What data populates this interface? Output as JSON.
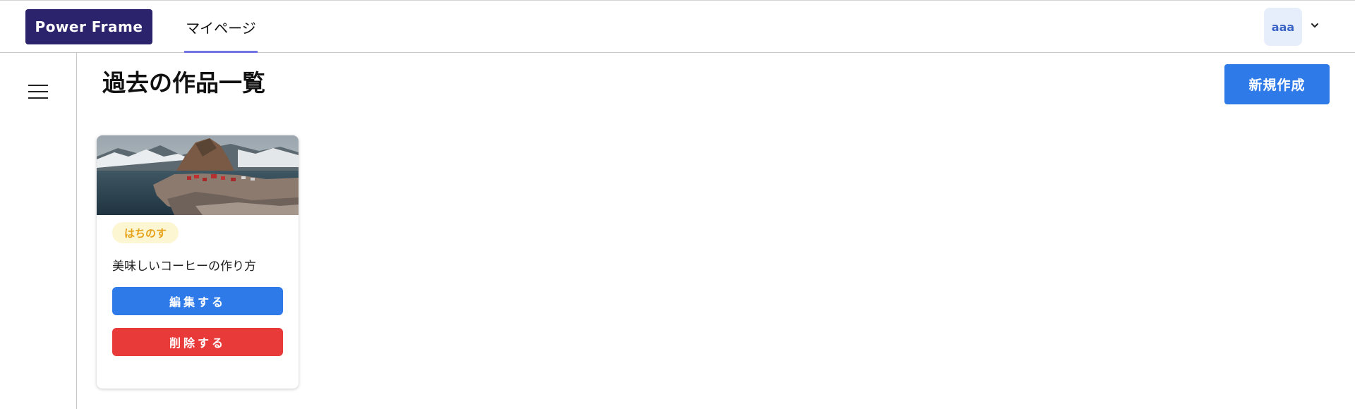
{
  "header": {
    "brand": "Power Frame",
    "nav_tab": "マイページ",
    "avatar_text": "aaa"
  },
  "main": {
    "title": "過去の作品一覧",
    "new_button": "新規作成"
  },
  "cards": [
    {
      "tag": "はちのす",
      "title": "美味しいコーヒーの作り方",
      "edit_label": "編集する",
      "delete_label": "削除する"
    }
  ],
  "colors": {
    "brand_bg": "#2b236b",
    "primary": "#2f7ae9",
    "danger": "#e93a3a",
    "tag_bg": "#fdf6d3",
    "tag_text": "#e6a21a",
    "nav_underline": "#6f74e0"
  },
  "icons": {
    "menu": "hamburger-icon",
    "account_menu": "chevron-down-icon"
  }
}
